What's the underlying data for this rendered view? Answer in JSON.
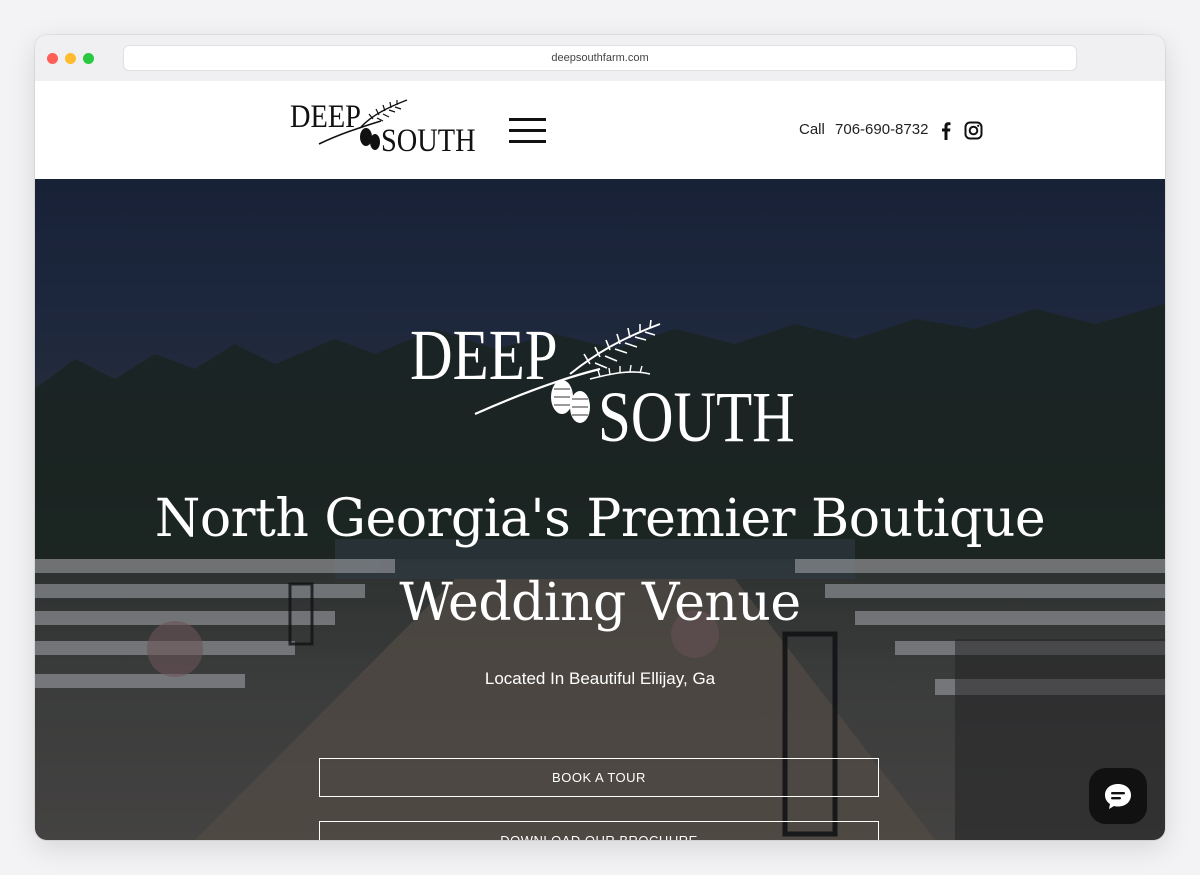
{
  "browser": {
    "url": "deepsouthfarm.com"
  },
  "header": {
    "logo_top": "DEEP",
    "logo_bottom": "SOUTH",
    "menu_icon": "hamburger-menu-icon",
    "call_label": "Call",
    "phone": "706-690-8732",
    "social": [
      {
        "name": "facebook-icon"
      },
      {
        "name": "instagram-icon"
      }
    ]
  },
  "hero": {
    "logo_top": "DEEP",
    "logo_bottom": "SOUTH",
    "headline_line1": "North Georgia's Premier Boutique",
    "headline_line2": "Wedding Venue",
    "subheadline": "Located In Beautiful Ellijay, Ga",
    "buttons": {
      "tour": "BOOK A TOUR",
      "brochure": "DOWNLOAD OUR BROCHURE"
    }
  },
  "chat": {
    "icon": "chat-bubble-icon"
  },
  "colors": {
    "header_bg": "#ffffff",
    "text_dark": "#111111",
    "hero_text": "#ffffff",
    "chat_bg": "#111111"
  }
}
